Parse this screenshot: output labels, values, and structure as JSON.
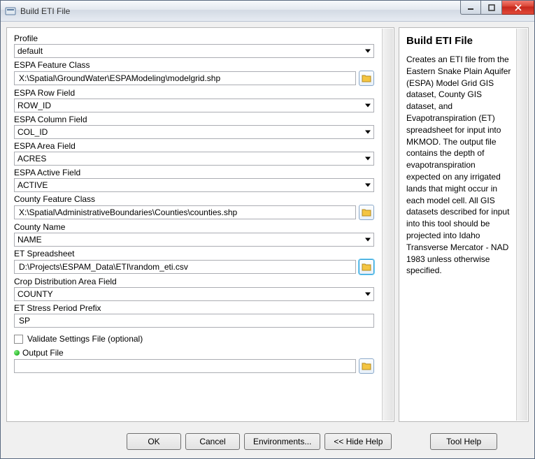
{
  "window": {
    "title": "Build ETI File"
  },
  "fields": {
    "profile": {
      "label": "Profile",
      "value": "default"
    },
    "espa_fc": {
      "label": "ESPA Feature Class",
      "value": "X:\\Spatial\\GroundWater\\ESPAModeling\\modelgrid.shp"
    },
    "espa_row": {
      "label": "ESPA Row Field",
      "value": "ROW_ID"
    },
    "espa_col": {
      "label": "ESPA Column Field",
      "value": "COL_ID"
    },
    "espa_area": {
      "label": "ESPA Area Field",
      "value": "ACRES"
    },
    "espa_active": {
      "label": "ESPA Active Field",
      "value": "ACTIVE"
    },
    "county_fc": {
      "label": "County Feature Class",
      "value": "X:\\Spatial\\AdministrativeBoundaries\\Counties\\counties.shp"
    },
    "county_name": {
      "label": "County Name",
      "value": "NAME"
    },
    "et_spread": {
      "label": "ET Spreadsheet",
      "value": "D:\\Projects\\ESPAM_Data\\ETI\\random_eti.csv"
    },
    "crop_dist": {
      "label": "Crop Distribution Area Field",
      "value": "COUNTY"
    },
    "et_prefix": {
      "label": "ET Stress Period Prefix",
      "value": "SP"
    },
    "validate": {
      "label": "Validate Settings File (optional)",
      "checked": false
    },
    "output": {
      "label": "Output File",
      "value": ""
    }
  },
  "buttons": {
    "ok": "OK",
    "cancel": "Cancel",
    "environments": "Environments...",
    "hide_help": "<< Hide Help",
    "tool_help": "Tool Help"
  },
  "help": {
    "title": "Build ETI File",
    "body": "Creates an ETI file from the Eastern Snake Plain Aquifer (ESPA) Model Grid GIS dataset, County GIS dataset, and Evapotranspiration (ET) spreadsheet for input into MKMOD. The output file contains the depth of evapotranspiration expected on any irrigated lands that might occur in each model cell. All GIS datasets described for input into this tool should be projected into Idaho Transverse Mercator - NAD 1983 unless otherwise specified."
  }
}
